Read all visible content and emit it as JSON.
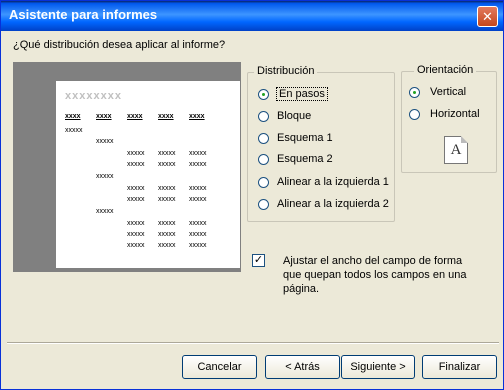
{
  "window": {
    "title": "Asistente para informes",
    "close_glyph": "✕"
  },
  "question": "¿Qué distribución desea aplicar al informe?",
  "preview": {
    "title_placeholder": "xxxxxxxx",
    "headers": [
      "xxxx",
      "xxxx",
      "xxxx",
      "xxxx",
      "xxxx"
    ],
    "level1": "xxxxx",
    "level2": "xxxxx",
    "cell": "xxxxx"
  },
  "distribution": {
    "label": "Distribución",
    "options": [
      {
        "label": "En pasos",
        "selected": true
      },
      {
        "label": "Bloque",
        "selected": false
      },
      {
        "label": "Esquema 1",
        "selected": false
      },
      {
        "label": "Esquema 2",
        "selected": false
      },
      {
        "label": "Alinear a la izquierda 1",
        "selected": false
      },
      {
        "label": "Alinear a la izquierda 2",
        "selected": false
      }
    ]
  },
  "orientation": {
    "label": "Orientación",
    "options": [
      {
        "label": "Vertical",
        "selected": true
      },
      {
        "label": "Horizontal",
        "selected": false
      }
    ],
    "page_icon": "page-portrait-icon",
    "page_letter": "A"
  },
  "adjust_width": {
    "checked": true,
    "check_glyph": "✓",
    "label": "Ajustar el ancho del campo de forma que quepan todos los campos en una página."
  },
  "buttons": {
    "cancel": "Cancelar",
    "back": "< Atrás",
    "next": "Siguiente >",
    "finish": "Finalizar"
  }
}
